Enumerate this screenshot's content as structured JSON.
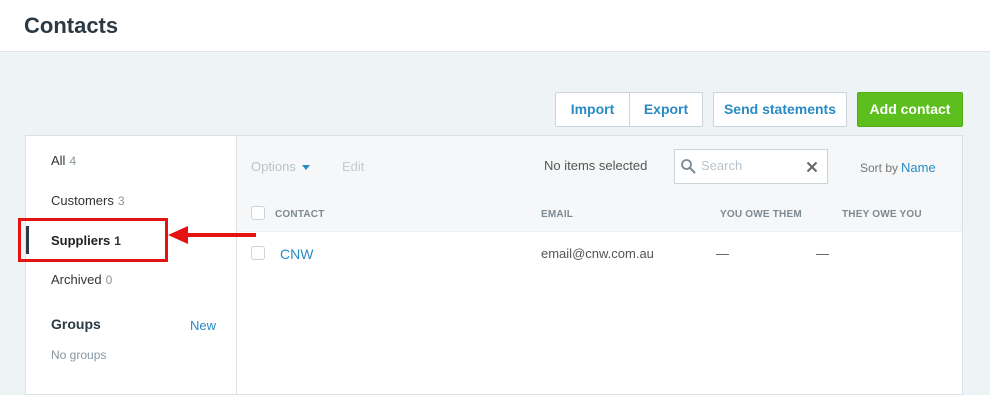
{
  "header": {
    "title": "Contacts"
  },
  "actions": {
    "import": "Import",
    "export": "Export",
    "send_statements": "Send statements",
    "add_contact": "Add contact"
  },
  "sidebar": {
    "items": [
      {
        "label": "All",
        "count": "4"
      },
      {
        "label": "Customers",
        "count": "3"
      },
      {
        "label": "Suppliers",
        "count": "1"
      },
      {
        "label": "Archived",
        "count": "0"
      }
    ],
    "active_item": "Suppliers",
    "groups_title": "Groups",
    "groups_new": "New",
    "no_groups": "No groups"
  },
  "toolbar": {
    "options": "Options",
    "edit": "Edit",
    "selection_status": "No items selected",
    "search_placeholder": "Search",
    "sort_label": "Sort by",
    "sort_value": "Name"
  },
  "table": {
    "columns": [
      "CONTACT",
      "EMAIL",
      "YOU OWE THEM",
      "THEY OWE YOU"
    ],
    "rows": [
      {
        "contact": "CNW",
        "email": "email@cnw.com.au",
        "you_owe_them": "—",
        "they_owe_you": "—"
      }
    ]
  },
  "colors": {
    "accent": "#2a8ac4",
    "primary_button": "#5cbf1e",
    "annotation": "#e51212"
  },
  "icons": [
    "search-icon",
    "clear-icon",
    "chevron-down-icon",
    "arrow-left-icon"
  ]
}
